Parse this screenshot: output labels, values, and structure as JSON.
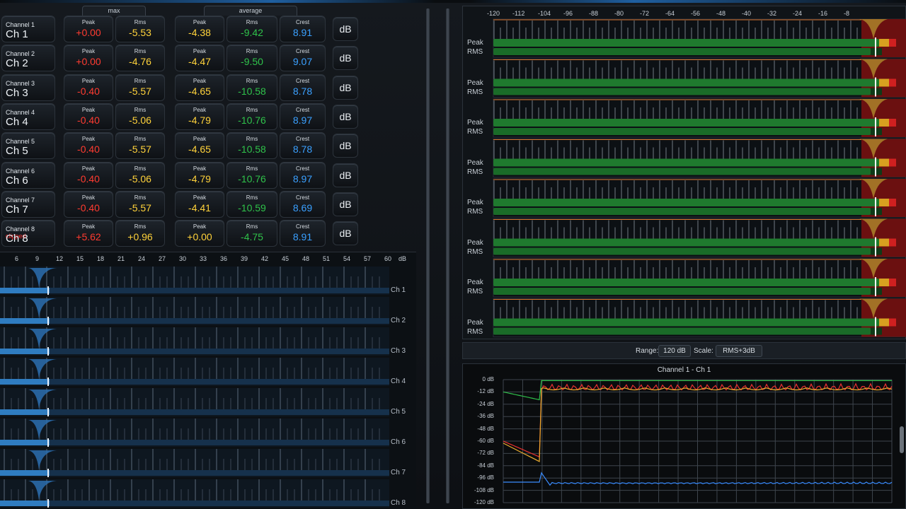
{
  "header": {
    "max_label": "max",
    "average_label": "average"
  },
  "channels": [
    {
      "sub": "Channel 1",
      "clipped": "",
      "name": "Ch 1",
      "max_peak": "+0.00",
      "max_rms": "-5.53",
      "avg_peak": "-4.38",
      "avg_rms": "-9.42",
      "crest": "8.91",
      "unit": "dB"
    },
    {
      "sub": "Channel 2",
      "clipped": "",
      "name": "Ch 2",
      "max_peak": "+0.00",
      "max_rms": "-4.76",
      "avg_peak": "-4.47",
      "avg_rms": "-9.50",
      "crest": "9.07",
      "unit": "dB"
    },
    {
      "sub": "Channel 3",
      "clipped": "",
      "name": "Ch 3",
      "max_peak": "-0.40",
      "max_rms": "-5.57",
      "avg_peak": "-4.65",
      "avg_rms": "-10.58",
      "crest": "8.78",
      "unit": "dB"
    },
    {
      "sub": "Channel 4",
      "clipped": "",
      "name": "Ch 4",
      "max_peak": "-0.40",
      "max_rms": "-5.06",
      "avg_peak": "-4.79",
      "avg_rms": "-10.76",
      "crest": "8.97",
      "unit": "dB"
    },
    {
      "sub": "Channel 5",
      "clipped": "",
      "name": "Ch 5",
      "max_peak": "-0.40",
      "max_rms": "-5.57",
      "avg_peak": "-4.65",
      "avg_rms": "-10.58",
      "crest": "8.78",
      "unit": "dB"
    },
    {
      "sub": "Channel 6",
      "clipped": "",
      "name": "Ch 6",
      "max_peak": "-0.40",
      "max_rms": "-5.06",
      "avg_peak": "-4.79",
      "avg_rms": "-10.76",
      "crest": "8.97",
      "unit": "dB"
    },
    {
      "sub": "Channel 7",
      "clipped": "",
      "name": "Ch 7",
      "max_peak": "-0.40",
      "max_rms": "-5.57",
      "avg_peak": "-4.41",
      "avg_rms": "-10.59",
      "crest": "8.69",
      "unit": "dB"
    },
    {
      "sub": "Channel 8",
      "clipped": "clipped",
      "name": "Ch 8",
      "max_peak": "+5.62",
      "max_rms": "+0.96",
      "avg_peak": "+0.00",
      "avg_rms": "-4.75",
      "crest": "8.91",
      "unit": "dB"
    }
  ],
  "cell_labels": {
    "peak": "Peak",
    "rms": "Rms",
    "crest": "Crest"
  },
  "crest_meter": {
    "scale": [
      "6",
      "9",
      "12",
      "15",
      "18",
      "21",
      "24",
      "27",
      "30",
      "33",
      "36",
      "39",
      "42",
      "45",
      "48",
      "51",
      "54",
      "57",
      "60"
    ],
    "unit": "dB",
    "rows": [
      "Ch 1",
      "Ch 2",
      "Ch 3",
      "Ch 4",
      "Ch 5",
      "Ch 6",
      "Ch 7",
      "Ch 8"
    ]
  },
  "level_meters": {
    "scale": [
      "-120",
      "-112",
      "-104",
      "-96",
      "-88",
      "-80",
      "-72",
      "-64",
      "-56",
      "-48",
      "-40",
      "-32",
      "-24",
      "-16",
      "-8"
    ],
    "peak_label": "Peak",
    "rms_label": "RMS",
    "rows": 8
  },
  "range_bar": {
    "range_label": "Range:",
    "range_value": "120 dB",
    "scale_label": "Scale:",
    "scale_value": "RMS+3dB"
  },
  "history": {
    "title": "Channel 1 - Ch 1",
    "y_labels": [
      "0 dB",
      "-12 dB",
      "-24 dB",
      "-36 dB",
      "-48 dB",
      "-60 dB",
      "-72 dB",
      "-84 dB",
      "-96 dB",
      "-108 dB",
      "-120 dB"
    ]
  },
  "colors": {
    "peak_red": "#ff3b30",
    "rms_yellow": "#ffd23a",
    "avg_green": "#2fc24a",
    "crest_blue": "#3aa0ff",
    "bar_green": "#1f7a2e"
  }
}
